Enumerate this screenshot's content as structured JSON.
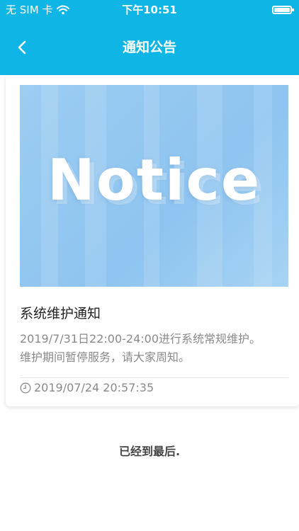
{
  "status_bar": {
    "carrier": "无 SIM 卡",
    "time": "下午10:51",
    "battery_level": 1.0
  },
  "nav": {
    "title": "通知公告"
  },
  "notice": {
    "banner_text": "Notice",
    "title": "系统维护通知",
    "body": "2019/7/31日22:00-24:00进行系统常规维护。维护期间暂停服务，请大家周知。",
    "timestamp": "2019/07/24 20:57:35"
  },
  "footer": {
    "end_text": "已经到最后."
  },
  "colors": {
    "header_bg": "#0fb5e5",
    "banner_bg": "#9ccdf2"
  },
  "icons": [
    "wifi-icon",
    "battery-icon",
    "back-chevron-icon",
    "clock-icon"
  ]
}
